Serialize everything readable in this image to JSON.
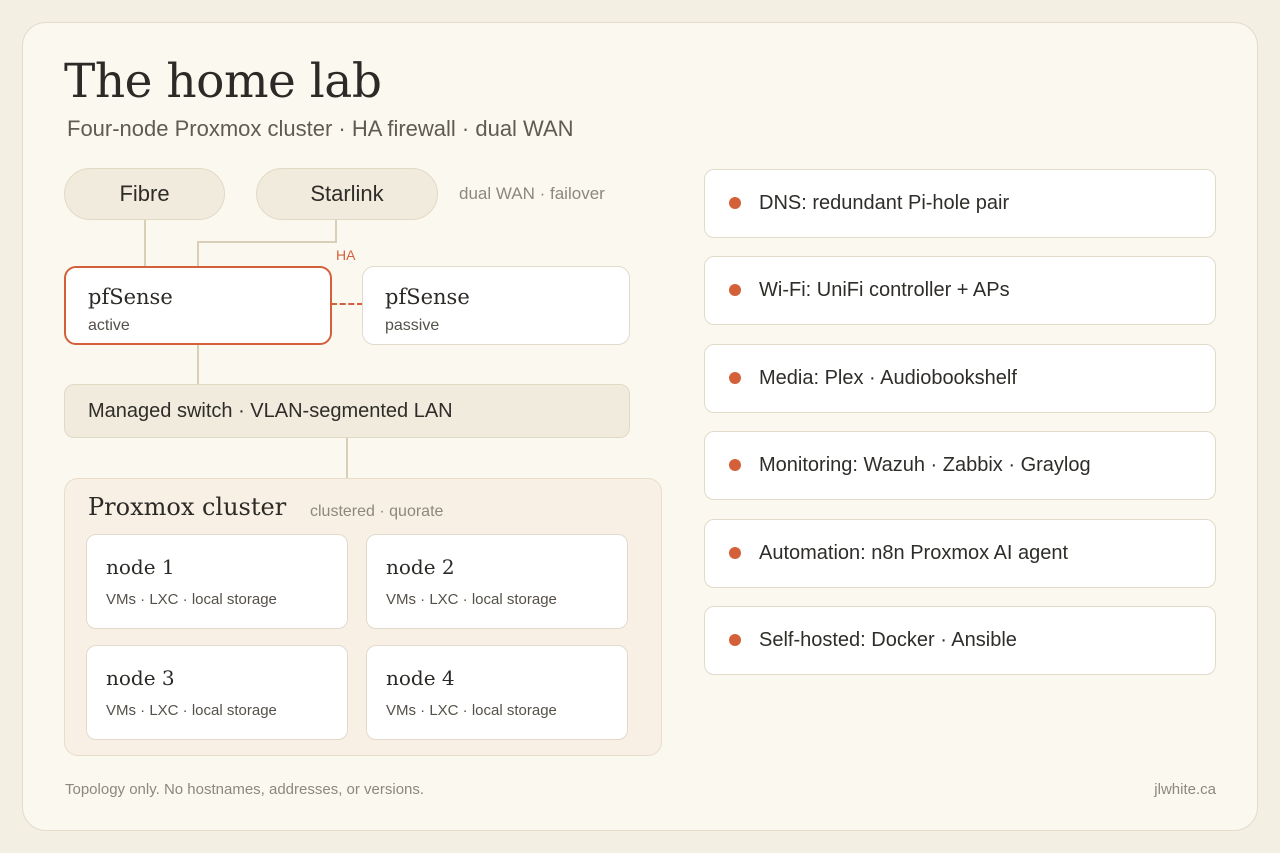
{
  "header": {
    "title": "The home lab",
    "subtitle": "Four-node Proxmox cluster · HA firewall · dual WAN"
  },
  "wan": {
    "links": [
      "Fibre",
      "Starlink"
    ],
    "note": "dual WAN · failover"
  },
  "firewall": {
    "ha_label": "HA",
    "primary": {
      "name": "pfSense",
      "state": "active"
    },
    "secondary": {
      "name": "pfSense",
      "state": "passive"
    }
  },
  "switch": {
    "label": "Managed switch · VLAN-segmented LAN"
  },
  "cluster": {
    "title": "Proxmox cluster",
    "tag": "clustered · quorate",
    "nodes": [
      {
        "name": "node 1",
        "desc": "VMs · LXC · local storage"
      },
      {
        "name": "node 2",
        "desc": "VMs · LXC · local storage"
      },
      {
        "name": "node 3",
        "desc": "VMs · LXC · local storage"
      },
      {
        "name": "node 4",
        "desc": "VMs · LXC · local storage"
      }
    ]
  },
  "services": [
    "DNS: redundant Pi-hole pair",
    "Wi-Fi: UniFi controller + APs",
    "Media: Plex · Audiobookshelf",
    "Monitoring: Wazuh · Zabbix · Graylog",
    "Automation: n8n Proxmox AI agent",
    "Self-hosted: Docker · Ansible"
  ],
  "footer": {
    "note": "Topology only. No hostnames, addresses, or versions.",
    "site": "jlwhite.ca"
  },
  "colors": {
    "accent": "#d4603a",
    "background": "#f4efe3",
    "card": "#fbf8f0",
    "connector": "#d9cfb8"
  }
}
